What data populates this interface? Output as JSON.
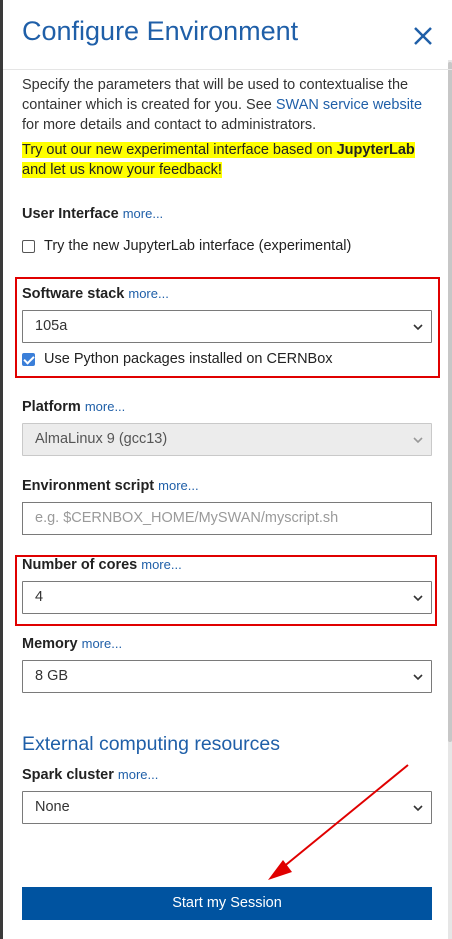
{
  "dialog": {
    "title": "Configure Environment",
    "close_label": "close"
  },
  "intro": {
    "text_before": "Specify the parameters that will be used to contextualise the container which is created for you. See ",
    "link_text": "SWAN service website",
    "text_after": " for more details and contact to administrators."
  },
  "notice": {
    "part1": "Try out our new experimental interface based on ",
    "bold": "JupyterLab",
    "part2": " and let us know your feedback!"
  },
  "more_label": "more...",
  "user_interface": {
    "label": "User Interface",
    "checkbox_label": "Try the new JupyterLab interface (experimental)",
    "checked": false
  },
  "software_stack": {
    "label": "Software stack",
    "value": "105a",
    "checkbox_label": "Use Python packages installed on CERNBox",
    "checked": true
  },
  "platform": {
    "label": "Platform",
    "value": "AlmaLinux 9 (gcc13)"
  },
  "environment_script": {
    "label": "Environment script",
    "placeholder": "e.g. $CERNBOX_HOME/MySWAN/myscript.sh"
  },
  "cores": {
    "label": "Number of cores",
    "value": "4"
  },
  "memory": {
    "label": "Memory",
    "value": "8 GB"
  },
  "external": {
    "title": "External computing resources"
  },
  "spark": {
    "label": "Spark cluster",
    "value": "None"
  },
  "start_button": "Start my Session",
  "colors": {
    "accent": "#1f5fa8",
    "button": "#0053a0",
    "highlight": "#ffff00",
    "annotation": "#e00000"
  }
}
